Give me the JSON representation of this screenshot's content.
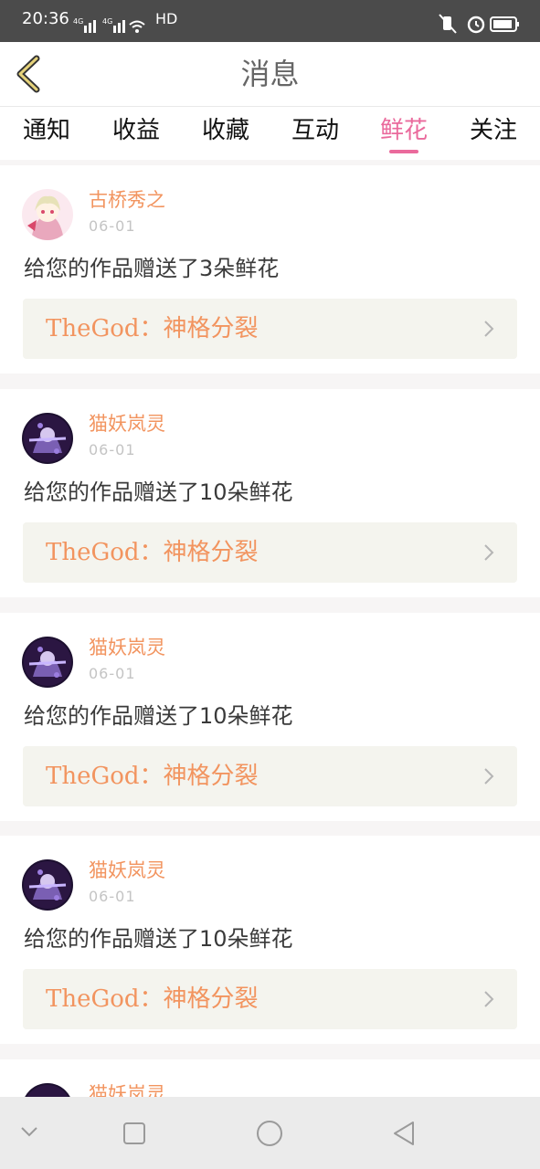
{
  "status_bar": {
    "time": "20:36",
    "network": "4G",
    "hd": "HD"
  },
  "header": {
    "title": "消息"
  },
  "tabs": [
    {
      "label": "通知"
    },
    {
      "label": "收益"
    },
    {
      "label": "收藏"
    },
    {
      "label": "互动"
    },
    {
      "label": "鲜花",
      "active": true
    },
    {
      "label": "关注"
    }
  ],
  "messages": [
    {
      "username": "古桥秀之",
      "date": "06-01",
      "text": "给您的作品赠送了3朵鲜花",
      "work_title": "TheGod：神格分裂"
    },
    {
      "username": "猫妖岚灵",
      "date": "06-01",
      "text": "给您的作品赠送了10朵鲜花",
      "work_title": "TheGod：神格分裂"
    },
    {
      "username": "猫妖岚灵",
      "date": "06-01",
      "text": "给您的作品赠送了10朵鲜花",
      "work_title": "TheGod：神格分裂"
    },
    {
      "username": "猫妖岚灵",
      "date": "06-01",
      "text": "给您的作品赠送了10朵鲜花",
      "work_title": "TheGod：神格分裂"
    },
    {
      "username": "猫妖岚灵"
    }
  ],
  "colors": {
    "accent": "#ea6a9c",
    "username": "#f2945f",
    "status_bar": "#4b4b4b",
    "card_link_bg": "#f4f4ee"
  },
  "icons": [
    "back-arrow-icon",
    "chevron-right-icon",
    "nav-down-icon",
    "nav-square-icon",
    "nav-circle-icon",
    "nav-back-triangle-icon"
  ]
}
